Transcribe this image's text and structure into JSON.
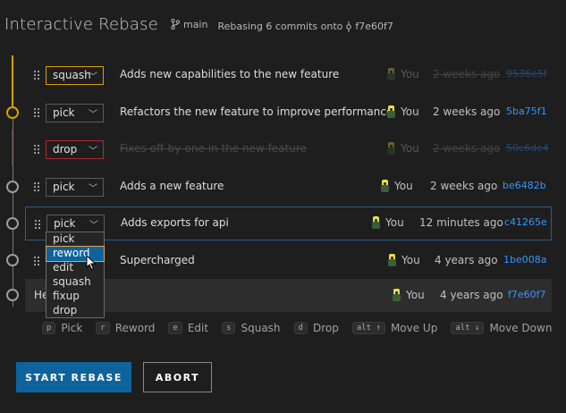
{
  "header": {
    "title": "Interactive Rebase",
    "branch": "main",
    "subtitle_prefix": "Rebasing 6 commits onto",
    "onto_sha": "f7e60f7"
  },
  "rows": [
    {
      "action": "squash",
      "message": "Adds new capabilities to the new feature",
      "author": "You",
      "date": "2 weeks ago",
      "sha": "9536e5f"
    },
    {
      "action": "pick",
      "message": "Refactors the new feature to improve performance",
      "author": "You",
      "date": "2 weeks ago",
      "sha": "5ba75f1"
    },
    {
      "action": "drop",
      "message": "Fixes off-by-one in the new feature",
      "author": "You",
      "date": "2 weeks ago",
      "sha": "50c6de4"
    },
    {
      "action": "pick",
      "message": "Adds a new feature",
      "author": "You",
      "date": "2 weeks ago",
      "sha": "be6482b"
    },
    {
      "action": "pick",
      "message": "Adds exports for api",
      "author": "You",
      "date": "12 minutes ago",
      "sha": "c41265e"
    },
    {
      "action": "",
      "message": "Supercharged",
      "author": "You",
      "date": "4 years ago",
      "sha": "1be008a"
    }
  ],
  "base_row": {
    "message": "He",
    "author": "You",
    "date": "4 years ago",
    "sha": "f7e60f7"
  },
  "dropdown": {
    "options": [
      "pick",
      "reword",
      "edit",
      "squash",
      "fixup",
      "drop"
    ],
    "highlighted": "reword"
  },
  "shortcuts": [
    {
      "key": "p",
      "label": "Pick"
    },
    {
      "key": "r",
      "label": "Reword"
    },
    {
      "key": "e",
      "label": "Edit"
    },
    {
      "key": "s",
      "label": "Squash"
    },
    {
      "key": "d",
      "label": "Drop"
    },
    {
      "key": "alt ↑",
      "label": "Move Up"
    },
    {
      "key": "alt ↓",
      "label": "Move Down"
    }
  ],
  "buttons": {
    "start": "START REBASE",
    "abort": "ABORT"
  },
  "colors": {
    "accent": "#0e639c",
    "squash": "#d4a000",
    "drop": "#b8262e",
    "sha": "#3794ff"
  }
}
